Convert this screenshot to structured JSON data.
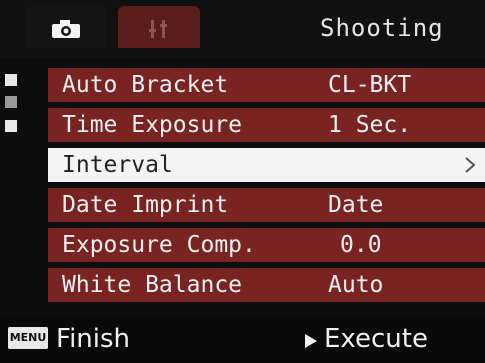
{
  "header": {
    "title": "Shooting",
    "tabs": [
      {
        "icon": "camera-icon",
        "active": true
      },
      {
        "icon": "tools-icon",
        "active": false
      }
    ]
  },
  "menu": {
    "items": [
      {
        "label": "Auto Bracket",
        "value": "CL-BKT",
        "selected": false
      },
      {
        "label": "Time Exposure",
        "value": "1 Sec.",
        "selected": false
      },
      {
        "label": "Interval",
        "value": "",
        "selected": true
      },
      {
        "label": "Date Imprint",
        "value": "Date",
        "selected": false
      },
      {
        "label": "Exposure Comp.",
        "value": "0.0",
        "selected": false
      },
      {
        "label": "White Balance",
        "value": "Auto",
        "selected": false
      }
    ]
  },
  "footer": {
    "menu_key": "MENU",
    "finish": "Finish",
    "execute": "Execute"
  },
  "colors": {
    "row_bg": "#7a2323",
    "selected_bg": "#f4f4f4",
    "tab_active_bg": "#5b1c1c"
  }
}
